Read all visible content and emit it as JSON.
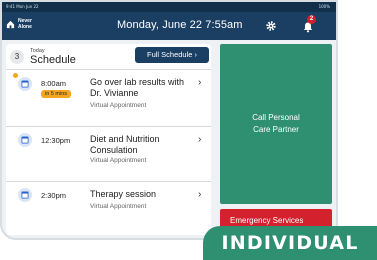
{
  "status_bar": {
    "left_text": "9:41  Mon Jun 22",
    "right_text": "100%"
  },
  "header": {
    "logo_line1": "Never",
    "logo_line2": "Alone",
    "date_time": "Monday, June 22  7:55am",
    "notification_count": "2"
  },
  "schedule": {
    "count": "3",
    "today_label": "Today",
    "title": "Schedule",
    "full_schedule_label": "Full Schedule  ›",
    "appointments": [
      {
        "time": "8:00am",
        "soon_tag": "in 5 mins",
        "title_line1": "Go over lab results with",
        "title_line2": "Dr. Vivianne",
        "subtitle": "Virtual Appointment"
      },
      {
        "time": "12:30pm",
        "title_line1": "Diet and Nutrition",
        "title_line2": "Consulation",
        "subtitle": "Virtual Appointment"
      },
      {
        "time": "2:30pm",
        "title_line1": "Therapy session",
        "subtitle": "Virtual Appointment"
      }
    ]
  },
  "actions": {
    "call_line1": "Call Personal",
    "call_line2": "Care Partner",
    "emergency_label": "Emergency Services"
  },
  "banner": {
    "label": "INDIVIDUAL"
  },
  "colors": {
    "header_bg": "#1b3f63",
    "call_bg": "#2f9071",
    "emergency_bg": "#d3222e",
    "soon_tag_bg": "#f4a623",
    "calendar_icon": "#2b63c9"
  },
  "icons": {
    "gear": "gear-icon",
    "bell": "bell-icon",
    "calendar": "calendar-icon",
    "chevron": "chevron-right-icon"
  }
}
